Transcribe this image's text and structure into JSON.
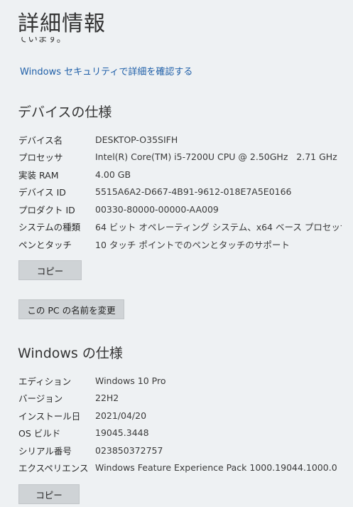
{
  "page": {
    "title": "詳細情報",
    "partial_text": "ています。",
    "security_link": "Windows セキュリティで詳細を確認する"
  },
  "device_specs": {
    "heading": "デバイスの仕様",
    "rows": [
      {
        "label": "デバイス名",
        "value": "DESKTOP-O35SIFH"
      },
      {
        "label": "プロセッサ",
        "value": "Intel(R) Core(TM) i5-7200U CPU @ 2.50GHz   2.71 GHz"
      },
      {
        "label": "実装 RAM",
        "value": "4.00 GB"
      },
      {
        "label": "デバイス ID",
        "value": "5515A6A2-D667-4B91-9612-018E7A5E0166"
      },
      {
        "label": "プロダクト ID",
        "value": "00330-80000-00000-AA009"
      },
      {
        "label": "システムの種類",
        "value": "64 ビット オペレーティング システム、x64 ベース プロセッサ"
      },
      {
        "label": "ペンとタッチ",
        "value": "10 タッチ ポイントでのペンとタッチのサポート"
      }
    ],
    "copy_button": "コピー",
    "rename_button": "この PC の名前を変更"
  },
  "windows_specs": {
    "heading": "Windows の仕様",
    "rows": [
      {
        "label": "エディション",
        "value": "Windows 10 Pro"
      },
      {
        "label": "バージョン",
        "value": "22H2"
      },
      {
        "label": "インストール日",
        "value": "2021/04/20"
      },
      {
        "label": "OS ビルド",
        "value": "19045.3448"
      },
      {
        "label": "シリアル番号",
        "value": "023850372757"
      },
      {
        "label": "エクスペリエンス",
        "value": "Windows Feature Experience Pack 1000.19044.1000.0"
      }
    ],
    "copy_button": "コピー"
  }
}
